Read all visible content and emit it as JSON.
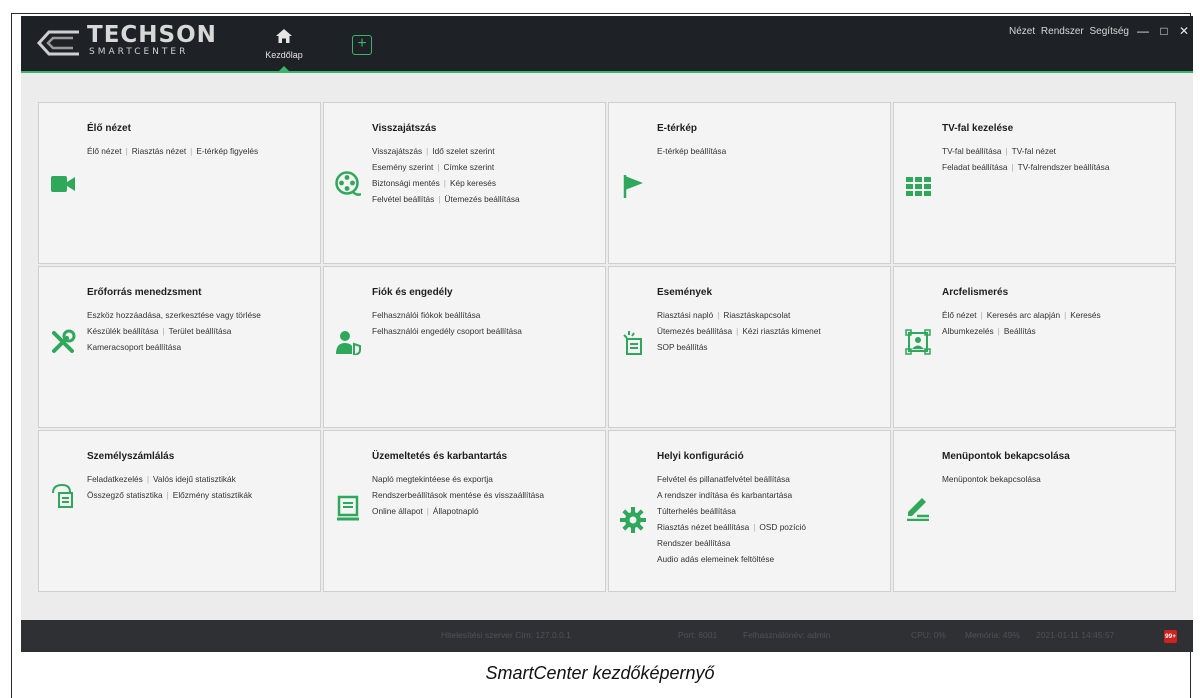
{
  "app": {
    "brand": "TECHSON",
    "brand_sub": "SMARTCENTER",
    "home_tab": "Kezdőlap",
    "add_tab": "+",
    "menus": [
      "Nézet",
      "Rendszer",
      "Segítség"
    ],
    "window_controls": [
      "minimize-icon",
      "maximize-icon",
      "close-icon"
    ],
    "accent_color": "#3bb46b"
  },
  "modules": [
    {
      "title": "Élő nézet",
      "icon": "camera-icon",
      "rows": [
        [
          "Élő nézet",
          "Riasztás nézet",
          "E-térkép figyelés"
        ]
      ]
    },
    {
      "title": "Visszajátszás",
      "icon": "film-reel-icon",
      "rows": [
        [
          "Visszajátszás",
          "Idő szelet szerint"
        ],
        [
          "Esemény szerint",
          "Címke szerint"
        ],
        [
          "Biztonsági mentés",
          "Kép keresés"
        ],
        [
          "Felvétel beállítás",
          "Ütemezés beállítása"
        ]
      ]
    },
    {
      "title": "E-térkép",
      "icon": "flag-icon",
      "rows": [
        [
          "E-térkép beállítása"
        ]
      ]
    },
    {
      "title": "TV-fal kezelése",
      "icon": "video-wall-icon",
      "rows": [
        [
          "TV-fal beállítása",
          "TV-fal nézet"
        ],
        [
          "Feladat beállítása",
          "TV-falrendszer beállítása"
        ]
      ]
    },
    {
      "title": "Erőforrás menedzsment",
      "icon": "tools-icon",
      "rows": [
        [
          "Eszköz hozzáadása, szerkesztése vagy törlése"
        ],
        [
          "Készülék beállítása",
          "Terület beállítása"
        ],
        [
          "Kameracsoport beállítása"
        ]
      ]
    },
    {
      "title": "Fiók és engedély",
      "icon": "user-shield-icon",
      "rows": [
        [
          "Felhasználói fiókok beállítása"
        ],
        [
          "Felhasználói engedély csoport beállítása"
        ]
      ]
    },
    {
      "title": "Események",
      "icon": "event-alarm-icon",
      "rows": [
        [
          "Riasztási napló",
          "Riasztáskapcsolat"
        ],
        [
          "Ütemezés beállítása",
          "Kézi riasztás kimenet"
        ],
        [
          "SOP beállítás"
        ]
      ]
    },
    {
      "title": "Arcfelismerés",
      "icon": "face-scan-icon",
      "rows": [
        [
          "Élő nézet",
          "Keresés arc alapján",
          "Keresés"
        ],
        [
          "Albumkezelés",
          "Beállítás"
        ]
      ]
    },
    {
      "title": "Személyszámlálás",
      "icon": "people-count-icon",
      "rows": [
        [
          "Feladatkezelés",
          "Valós idejű statisztikák"
        ],
        [
          "Összegző statisztika",
          "Előzmény statisztikák"
        ]
      ]
    },
    {
      "title": "Üzemeltetés és karbantartás",
      "icon": "monitor-icon",
      "rows": [
        [
          "Napló megtekintéese és exportja"
        ],
        [
          "Rendszerbeállítások mentése és visszaállítása"
        ],
        [
          "Online állapot",
          "Állapotnapló"
        ]
      ]
    },
    {
      "title": "Helyi konfiguráció",
      "icon": "gear-icon",
      "rows": [
        [
          "Felvétel és pillanatfelvétel beállítása"
        ],
        [
          "A rendszer indítása és karbantartása"
        ],
        [
          "Túlterhelés beállítása"
        ],
        [
          "Riasztás nézet beállítása",
          "OSD pozíció"
        ],
        [
          "Rendszer beállítása"
        ],
        [
          "Audio adás elemeinek feltöltése"
        ]
      ]
    },
    {
      "title": "Menüpontok bekapcsolása",
      "icon": "edit-icon",
      "rows": [
        [
          "Menüpontok bekapcsolása"
        ]
      ]
    }
  ],
  "status": {
    "server": "Hitelesítési szerver Cím: 127.0.0.1",
    "port": "Port: 6001",
    "user": "Felhasználónév: admin",
    "cpu": "CPU: 0%",
    "memory": "Memória: 49%",
    "datetime": "2021-01-11 14:45:57",
    "badge": "99+"
  },
  "caption": "SmartCenter kezdőképernyő"
}
